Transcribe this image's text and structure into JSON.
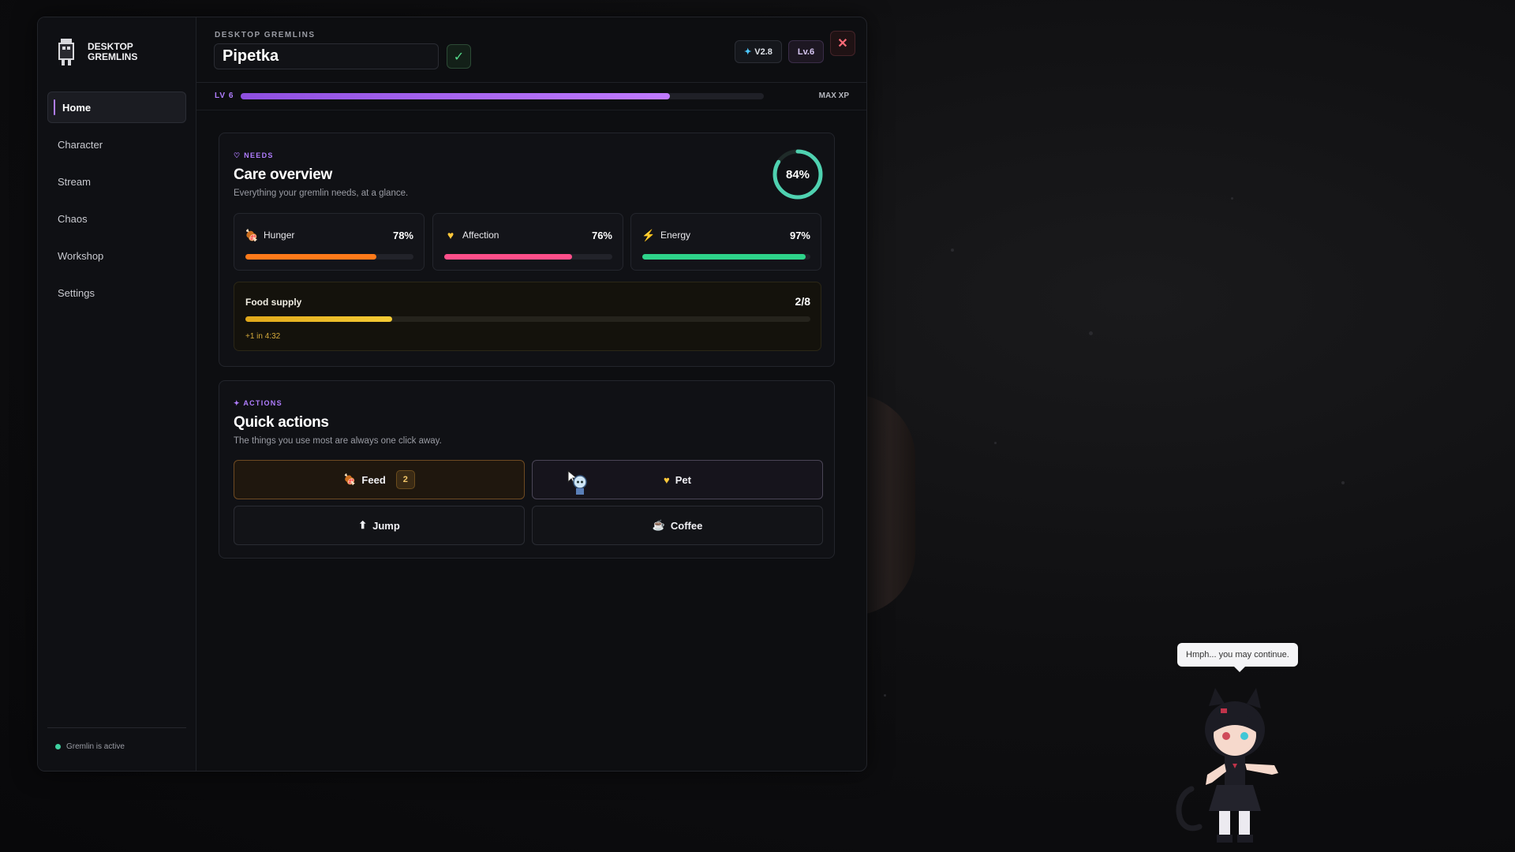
{
  "sidebar": {
    "brand": "DESKTOP GREMLINS",
    "items": [
      {
        "label": "Home",
        "active": true
      },
      {
        "label": "Character"
      },
      {
        "label": "Stream"
      },
      {
        "label": "Chaos"
      },
      {
        "label": "Workshop"
      },
      {
        "label": "Settings"
      }
    ],
    "status": "Gremlin is active"
  },
  "header": {
    "kicker": "DESKTOP GREMLINS",
    "name_value": "Pipetka",
    "confirm_icon": "check-icon",
    "version": "V2.8",
    "level_badge": "Lv.6",
    "close_icon": "close-icon"
  },
  "xp": {
    "level": "LV 6",
    "label": "MAX XP",
    "progress": 0.82
  },
  "needs": {
    "kicker": "NEEDS",
    "title": "Care overview",
    "subtitle": "Everything your gremlin needs, at a glance.",
    "overall": "84%",
    "overall_value": 0.84,
    "stats": [
      {
        "label": "Hunger",
        "value": "78%",
        "fill": 0.78,
        "icon": "meat-icon",
        "color": "#ff7a1a"
      },
      {
        "label": "Affection",
        "value": "76%",
        "fill": 0.76,
        "icon": "heart-icon",
        "color": "#ff4f8a"
      },
      {
        "label": "Energy",
        "value": "97%",
        "fill": 0.97,
        "icon": "lightning-icon",
        "color": "#2ed38a"
      }
    ],
    "food": {
      "label": "Food supply",
      "value": "2/8",
      "fill": 0.26,
      "next": "+1 in 4:32"
    }
  },
  "actions": {
    "kicker": "ACTIONS",
    "title": "Quick actions",
    "subtitle": "The things you use most are always one click away.",
    "feed": {
      "label": "Feed",
      "count": "2"
    },
    "pet": {
      "label": "Pet"
    },
    "jump": {
      "label": "Jump"
    },
    "coffee": {
      "label": "Coffee"
    }
  },
  "overlay": {
    "speech": "Hmph... you may continue."
  },
  "colors": {
    "accent": "#b07dff",
    "ring": "#4fd1b0"
  }
}
